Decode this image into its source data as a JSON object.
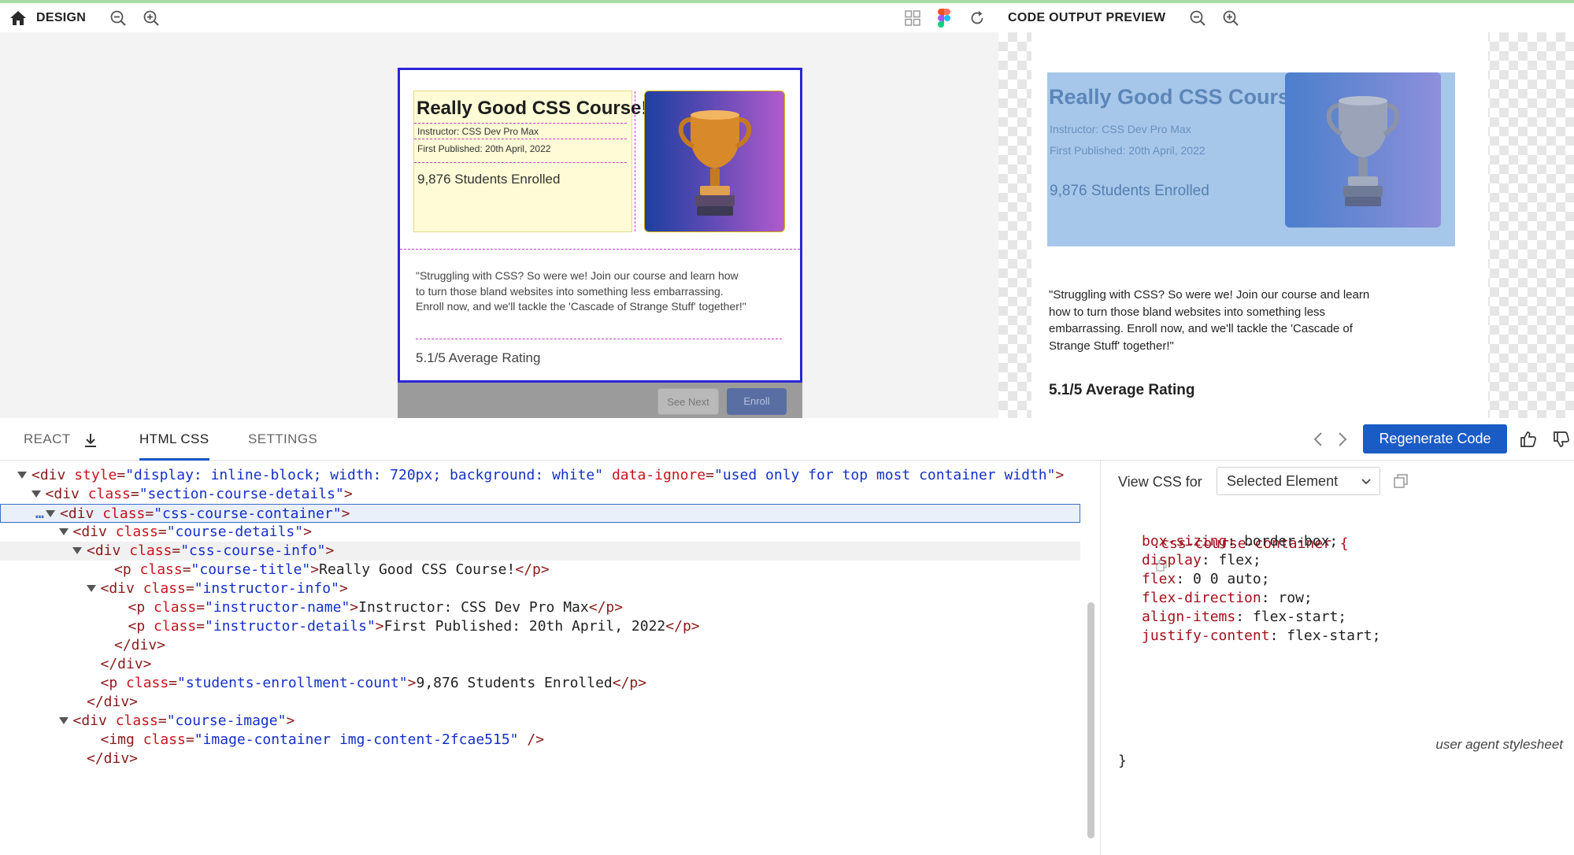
{
  "design_panel": {
    "title": "DESIGN",
    "card": {
      "course_title": "Really Good CSS Course!",
      "instructor": "Instructor: CSS Dev Pro Max",
      "published": "First Published: 20th April, 2022",
      "enrolled": "9,876 Students Enrolled",
      "quote": "\"Struggling with CSS? So were we! Join our course and learn how to turn those bland websites into something less embarrassing. Enroll now, and we'll tackle the 'Cascade of Strange Stuff' together!\"",
      "rating": "5.1/5 Average Rating",
      "see_next_label": "See Next",
      "enroll_label": "Enroll"
    }
  },
  "preview_panel": {
    "title": "CODE OUTPUT PREVIEW",
    "card": {
      "course_title": "Really Good CSS Course!",
      "instructor": "Instructor: CSS Dev Pro Max",
      "published": "First Published: 20th April, 2022",
      "enrolled": "9,876 Students Enrolled",
      "quote": "\"Struggling with CSS? So were we! Join our course and learn how to turn those bland websites into something less embarrassing. Enroll now, and we'll tackle the 'Cascade of Strange Stuff' together!\"",
      "rating": "5.1/5 Average Rating"
    }
  },
  "tabs": {
    "react": "REACT",
    "html_css": "HTML CSS",
    "settings": "SETTINGS"
  },
  "regenerate_label": "Regenerate Code",
  "code": {
    "lines": [
      {
        "indent": 1,
        "open": true,
        "parts": [
          [
            "tag",
            "<div "
          ],
          [
            "attr",
            "style"
          ],
          [
            "tag",
            "="
          ],
          [
            "val",
            "\"display: inline-block; width: 720px; background: white\""
          ],
          [
            "tag",
            " "
          ],
          [
            "attr",
            "data-ignore"
          ],
          [
            "tag",
            "="
          ],
          [
            "val",
            "\"used only for top most container width\""
          ],
          [
            "tag",
            ">"
          ]
        ]
      },
      {
        "indent": 2,
        "open": true,
        "parts": [
          [
            "tag",
            "<div "
          ],
          [
            "attr",
            "class"
          ],
          [
            "tag",
            "="
          ],
          [
            "val",
            "\"section-course-details\""
          ],
          [
            "tag",
            ">"
          ]
        ]
      },
      {
        "indent": 3,
        "open": true,
        "parts": [
          [
            "tag",
            "<div "
          ],
          [
            "attr",
            "class"
          ],
          [
            "tag",
            "="
          ],
          [
            "val",
            "\"css-course-container\""
          ],
          [
            "tag",
            ">"
          ]
        ]
      },
      {
        "indent": 4,
        "open": true,
        "parts": [
          [
            "tag",
            "<div "
          ],
          [
            "attr",
            "class"
          ],
          [
            "tag",
            "="
          ],
          [
            "val",
            "\"course-details\""
          ],
          [
            "tag",
            ">"
          ]
        ]
      },
      {
        "indent": 5,
        "open": true,
        "parts": [
          [
            "tag",
            "<div "
          ],
          [
            "attr",
            "class"
          ],
          [
            "tag",
            "="
          ],
          [
            "val",
            "\"css-course-info\""
          ],
          [
            "tag",
            ">"
          ]
        ]
      },
      {
        "indent": 7,
        "open": false,
        "parts": [
          [
            "tag",
            "<p "
          ],
          [
            "attr",
            "class"
          ],
          [
            "tag",
            "="
          ],
          [
            "val",
            "\"course-title\""
          ],
          [
            "tag",
            ">"
          ],
          [
            "text",
            "Really Good CSS Course!"
          ],
          [
            "tag",
            "</p>"
          ]
        ]
      },
      {
        "indent": 6,
        "open": true,
        "parts": [
          [
            "tag",
            "<div "
          ],
          [
            "attr",
            "class"
          ],
          [
            "tag",
            "="
          ],
          [
            "val",
            "\"instructor-info\""
          ],
          [
            "tag",
            ">"
          ]
        ]
      },
      {
        "indent": 8,
        "open": false,
        "parts": [
          [
            "tag",
            "<p "
          ],
          [
            "attr",
            "class"
          ],
          [
            "tag",
            "="
          ],
          [
            "val",
            "\"instructor-name\""
          ],
          [
            "tag",
            ">"
          ],
          [
            "text",
            "Instructor: CSS Dev Pro Max"
          ],
          [
            "tag",
            "</p>"
          ]
        ]
      },
      {
        "indent": 8,
        "open": false,
        "parts": [
          [
            "tag",
            "<p "
          ],
          [
            "attr",
            "class"
          ],
          [
            "tag",
            "="
          ],
          [
            "val",
            "\"instructor-details\""
          ],
          [
            "tag",
            ">"
          ],
          [
            "text",
            "First Published: 20th April, 2022"
          ],
          [
            "tag",
            "</p>"
          ]
        ]
      },
      {
        "indent": 7,
        "open": false,
        "parts": [
          [
            "tag",
            "</div>"
          ]
        ]
      },
      {
        "indent": 6,
        "open": false,
        "parts": [
          [
            "tag",
            "</div>"
          ]
        ]
      },
      {
        "indent": 6,
        "open": false,
        "parts": [
          [
            "tag",
            "<p "
          ],
          [
            "attr",
            "class"
          ],
          [
            "tag",
            "="
          ],
          [
            "val",
            "\"students-enrollment-count\""
          ],
          [
            "tag",
            ">"
          ],
          [
            "text",
            "9,876 Students Enrolled"
          ],
          [
            "tag",
            "</p>"
          ]
        ]
      },
      {
        "indent": 5,
        "open": false,
        "parts": [
          [
            "tag",
            "</div>"
          ]
        ]
      },
      {
        "indent": 4,
        "open": true,
        "parts": [
          [
            "tag",
            "<div "
          ],
          [
            "attr",
            "class"
          ],
          [
            "tag",
            "="
          ],
          [
            "val",
            "\"course-image\""
          ],
          [
            "tag",
            ">"
          ]
        ]
      },
      {
        "indent": 6,
        "open": false,
        "parts": [
          [
            "tag",
            "<img "
          ],
          [
            "attr",
            "class"
          ],
          [
            "tag",
            "="
          ],
          [
            "val",
            "\"image-container img-content-2fcae515\""
          ],
          [
            "tag",
            " />"
          ]
        ]
      },
      {
        "indent": 5,
        "open": false,
        "parts": [
          [
            "tag",
            "</div>"
          ]
        ]
      }
    ]
  },
  "css_panel": {
    "view_label": "View CSS for",
    "select_value": "Selected Element",
    "selector": ".css-course-container {",
    "props": [
      [
        "box-sizing",
        "border-box;"
      ],
      [
        "display",
        "flex;"
      ],
      [
        "flex",
        "0 0 auto;"
      ],
      [
        "flex-direction",
        "row;"
      ],
      [
        "align-items",
        "flex-start;"
      ],
      [
        "justify-content",
        "flex-start;"
      ]
    ],
    "closing": "}",
    "footer_note": "user agent stylesheet"
  },
  "colors": {
    "accent": "#1a5bc6",
    "selection_border": "#3b6cc9",
    "design_card_border": "#2b25d8",
    "guide_dashes": "#c43ad1"
  }
}
